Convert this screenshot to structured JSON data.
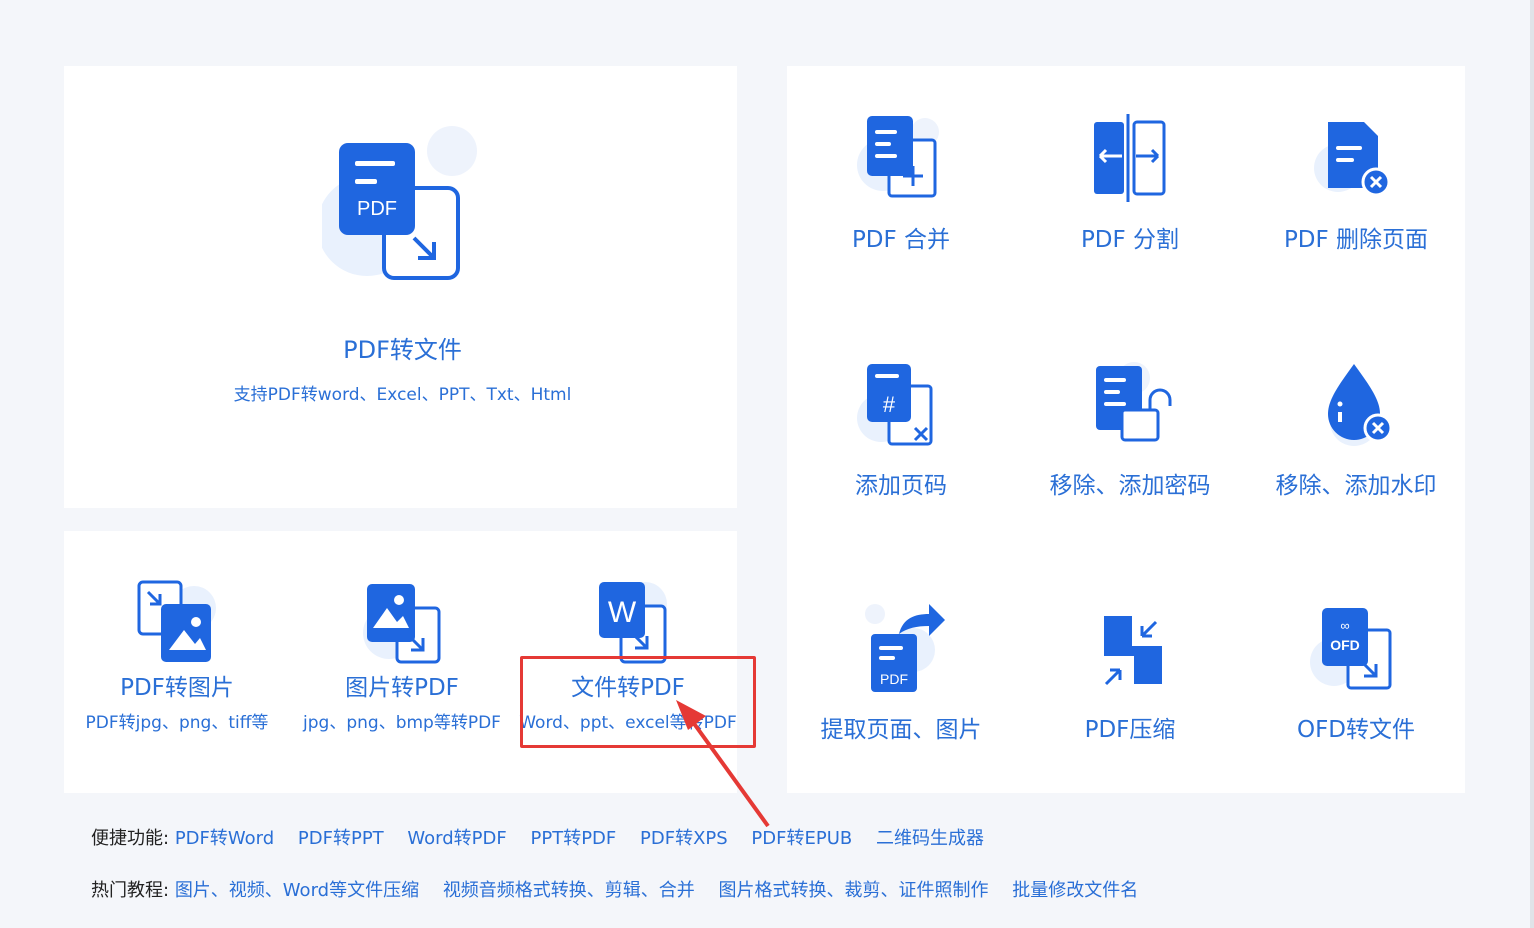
{
  "main_card": {
    "title": "PDF转文件",
    "subtitle": "支持PDF转word、Excel、PPT、Txt、Html",
    "icon_text": "PDF",
    "icon": "pdf-convert-icon"
  },
  "small_cards": [
    {
      "title": "PDF转图片",
      "subtitle": "PDF转jpg、png、tiff等",
      "icon": "pdf-to-image-icon"
    },
    {
      "title": "图片转PDF",
      "subtitle": "jpg、png、bmp等转PDF",
      "icon": "image-to-pdf-icon"
    },
    {
      "title": "文件转PDF",
      "subtitle": "Word、ppt、excel等转PDF",
      "icon": "word-to-pdf-icon",
      "icon_text": "W"
    }
  ],
  "tools": [
    {
      "label": "PDF 合并",
      "icon": "pdf-merge-icon"
    },
    {
      "label": "PDF 分割",
      "icon": "pdf-split-icon"
    },
    {
      "label": "PDF 删除页面",
      "icon": "pdf-delete-page-icon"
    },
    {
      "label": "添加页码",
      "icon": "page-number-icon"
    },
    {
      "label": "移除、添加密码",
      "icon": "password-lock-icon"
    },
    {
      "label": "移除、添加水印",
      "icon": "watermark-drop-icon"
    },
    {
      "label": "提取页面、图片",
      "icon": "extract-page-icon",
      "icon_text": "PDF"
    },
    {
      "label": "PDF压缩",
      "icon": "pdf-compress-icon"
    },
    {
      "label": "OFD转文件",
      "icon": "ofd-convert-icon",
      "icon_text": "OFD"
    }
  ],
  "quick_links": {
    "label": "便捷功能:",
    "items": [
      "PDF转Word",
      "PDF转PPT",
      "Word转PDF",
      "PPT转PDF",
      "PDF转XPS",
      "PDF转EPUB",
      "二维码生成器"
    ]
  },
  "tutorials": {
    "label": "热门教程:",
    "items": [
      "图片、视频、Word等文件压缩",
      "视频音频格式转换、剪辑、合并",
      "图片格式转换、裁剪、证件照制作",
      "批量修改文件名"
    ]
  },
  "colors": {
    "accent": "#2a6fd6",
    "icon_blue": "#1f66e0",
    "highlight": "#e53935",
    "background": "#f4f6fa"
  }
}
